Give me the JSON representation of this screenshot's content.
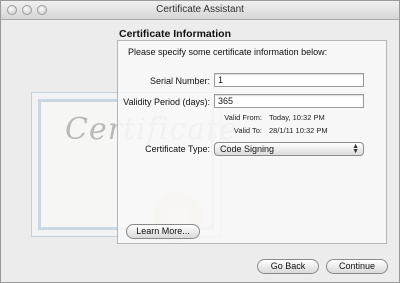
{
  "window": {
    "title": "Certificate Assistant"
  },
  "cert_art": {
    "word": "Certificate"
  },
  "section": {
    "heading": "Certificate Information",
    "prompt": "Please specify some certificate information below:"
  },
  "form": {
    "serial_label": "Serial Number:",
    "serial_value": "1",
    "validity_label": "Validity Period (days):",
    "validity_value": "365",
    "valid_from_label": "Valid From:",
    "valid_from_value": "Today, 10:32 PM",
    "valid_to_label": "Valid To:",
    "valid_to_value": "28/1/11 10:32 PM",
    "cert_type_label": "Certificate Type:",
    "cert_type_value": "Code Signing"
  },
  "buttons": {
    "learn_more": "Learn More...",
    "go_back": "Go Back",
    "continue": "Continue"
  }
}
